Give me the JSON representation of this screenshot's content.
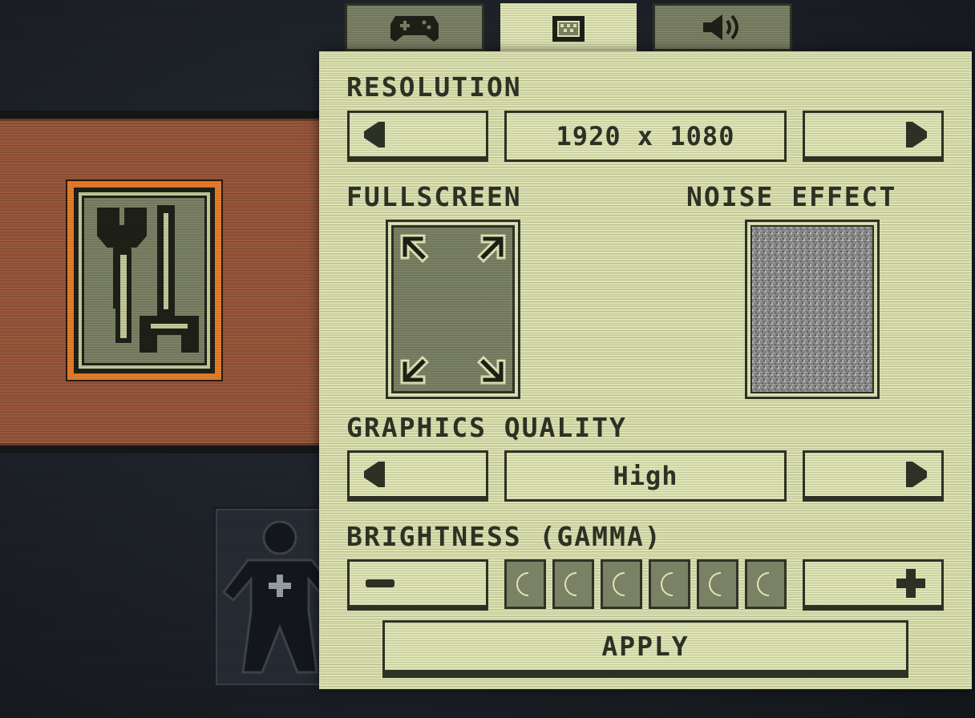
{
  "tabs": [
    {
      "icon": "gamepad-icon",
      "active": false
    },
    {
      "icon": "display-icon",
      "active": true
    },
    {
      "icon": "speaker-icon",
      "active": false
    }
  ],
  "settings": {
    "resolution": {
      "label": "RESOLUTION",
      "value": "1920 x 1080"
    },
    "fullscreen": {
      "label": "FULLSCREEN",
      "icon": "expand-arrows-icon"
    },
    "noise": {
      "label": "NOISE EFFECT",
      "icon": "static-noise-icon"
    },
    "quality": {
      "label": "GRAPHICS QUALITY",
      "value": "High"
    },
    "brightness": {
      "label": "BRIGHTNESS (GAMMA)",
      "level": 6,
      "max": 6
    },
    "apply_label": "APPLY"
  },
  "background": {
    "tool_card_icon": "wrench-icon",
    "character_icon": "character-silhouette-icon"
  },
  "colors": {
    "panel": "#dfe5b5",
    "dark": "#2f3326",
    "olive": "#7b8165",
    "accent_orange": "#e87d2a"
  }
}
